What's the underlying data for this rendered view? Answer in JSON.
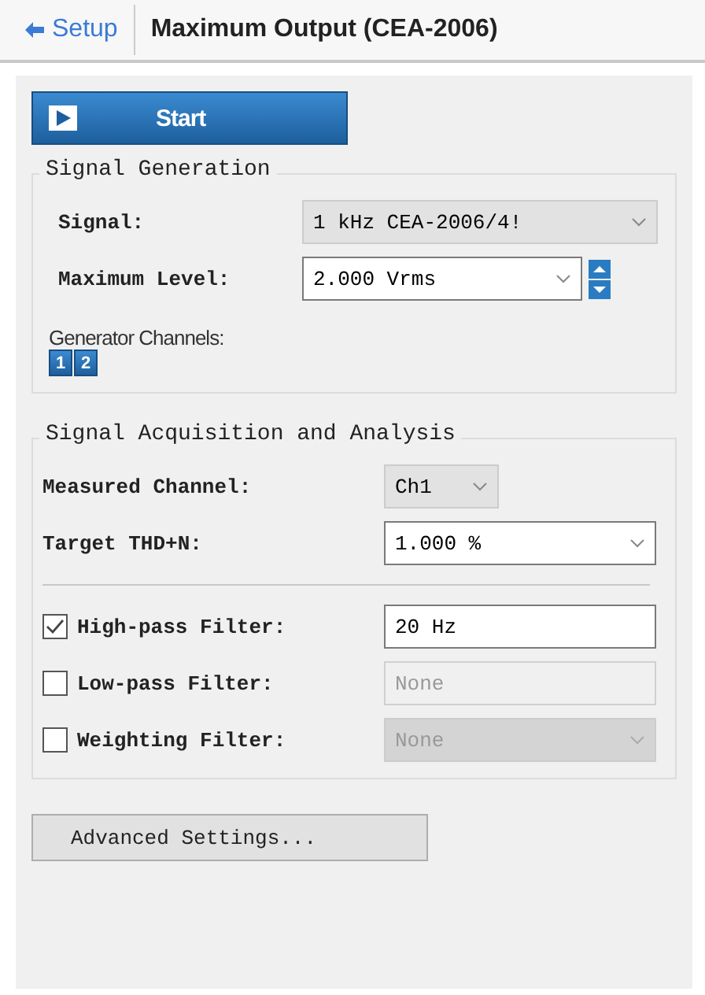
{
  "header": {
    "back_label": "Setup",
    "title": "Maximum Output (CEA-2006)"
  },
  "start_button": {
    "label": "Start"
  },
  "signal_generation": {
    "title": "Signal Generation",
    "signal": {
      "label": "Signal:",
      "value": "1 kHz CEA-2006/4!"
    },
    "maximum_level": {
      "label": "Maximum Level:",
      "value": "2.000 Vrms"
    },
    "generator_channels": {
      "label": "Generator Channels:",
      "channels": [
        {
          "label": "1",
          "selected": true
        },
        {
          "label": "2",
          "selected": true
        }
      ]
    }
  },
  "acquisition": {
    "title": "Signal Acquisition and Analysis",
    "measured_channel": {
      "label": "Measured Channel:",
      "value": "Ch1"
    },
    "target_thd": {
      "label": "Target THD+N:",
      "value": "1.000 %"
    },
    "filters": [
      {
        "kind": "text",
        "label": "High-pass Filter:",
        "checked": true,
        "value": "20 Hz",
        "disabled": false
      },
      {
        "kind": "text",
        "label": "Low-pass Filter:",
        "checked": false,
        "value": "None",
        "disabled": true
      },
      {
        "kind": "dropdown",
        "label": "Weighting Filter:",
        "checked": false,
        "value": "None",
        "disabled": true
      }
    ]
  },
  "advanced_button": {
    "label": "Advanced Settings..."
  }
}
